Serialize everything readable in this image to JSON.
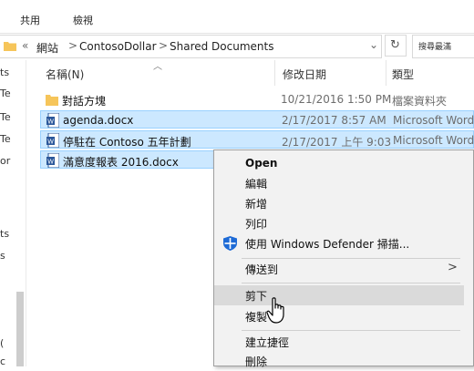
{
  "ribbon": {
    "tabs": [
      "共用",
      "檢視"
    ]
  },
  "address": {
    "back_label": "«",
    "crumbs": [
      "網站",
      "ContosoDollar",
      "Shared Documents"
    ],
    "separator": ">",
    "dropdown_glyph": "⌄",
    "refresh_glyph": "↻",
    "search_placeholder": "搜尋最滿"
  },
  "nav": {
    "fragments": [
      "ts",
      "Te",
      "Te",
      "Te",
      "or",
      "ts",
      "s",
      "(",
      "c"
    ]
  },
  "columns": {
    "name": "名稱(N)",
    "date": "修改日期",
    "type": "類型"
  },
  "files": [
    {
      "name": "對話方塊",
      "date": "10/21/2016 1:50 PM",
      "type": "檔案資料夾",
      "icon": "folder-icon",
      "selected": false
    },
    {
      "name": "agenda.docx",
      "date": "2/17/2017 8:57 AM",
      "type": "Microsoft Word",
      "icon": "word-doc-icon",
      "selected": true
    },
    {
      "name": "停駐在 Contoso 五年計劃",
      "date": "2/17/2017 上午 9:03",
      "type": "Microsoft Word",
      "icon": "word-doc-icon",
      "selected": true
    },
    {
      "name": "滿意度報表 2016.docx",
      "date": "",
      "type": "",
      "icon": "word-doc-icon",
      "selected": true
    }
  ],
  "context_menu": {
    "items": {
      "open": "Open",
      "edit": "編輯",
      "new": "新增",
      "print": "列印",
      "defender": "使用 Windows Defender 掃描...",
      "send_to": "傳送到",
      "cut": "剪下",
      "copy": "複製",
      "shortcut": "建立捷徑",
      "delete": "刪除"
    },
    "highlighted": "cut",
    "submenu_arrow": ">"
  },
  "colors": {
    "selection": "#cce8ff",
    "selection_border": "#99d1ff",
    "menu_bg": "#f2f2f2",
    "menu_highlight": "#dadada",
    "folder": "#f6c55a",
    "word_blue": "#2b579a"
  }
}
